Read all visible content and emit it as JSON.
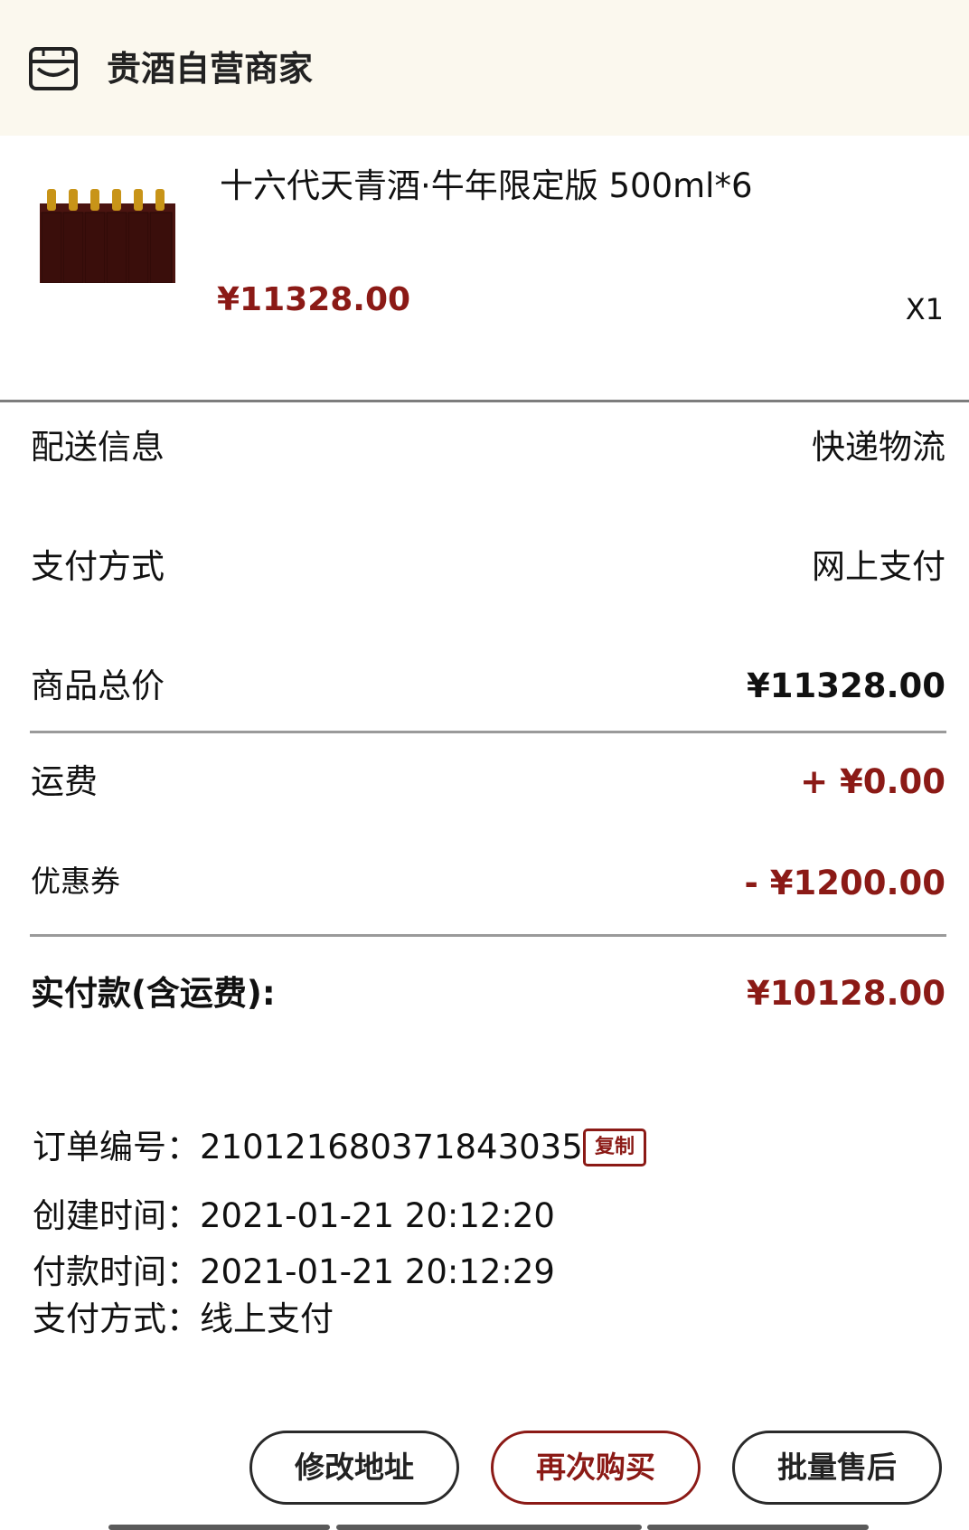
{
  "shop": {
    "name": "贵酒自营商家",
    "icon": "store-icon"
  },
  "product": {
    "title": "十六代天青酒·牛年限定版 500ml*6",
    "price": "¥11328.00",
    "quantity": "X1",
    "image": "wine-bottles-image"
  },
  "summary": {
    "delivery": {
      "label": "配送信息",
      "value": "快递物流"
    },
    "payment_method": {
      "label": "支付方式",
      "value": "网上支付"
    },
    "goods_total": {
      "label": "商品总价",
      "value": "¥11328.00"
    },
    "shipping": {
      "label": "运费",
      "value": "+ ¥0.00"
    },
    "coupon": {
      "label": "优惠券",
      "value": "- ¥1200.00"
    },
    "paid": {
      "label": "实付款(含运费):",
      "value": "¥10128.00"
    }
  },
  "order_meta": {
    "order_no": "订单编号：210121680371843035",
    "copy_label": "复制",
    "created": "创建时间：2021-01-21 20:12:20",
    "paid_time": "付款时间：2021-01-21 20:12:29",
    "pay_method": "支付方式：线上支付"
  },
  "actions": {
    "modify_address": "修改地址",
    "buy_again": "再次购买",
    "after_sales": "批量售后"
  },
  "colors": {
    "accent": "#8b1a16",
    "header_bg": "#fbf8ee"
  }
}
